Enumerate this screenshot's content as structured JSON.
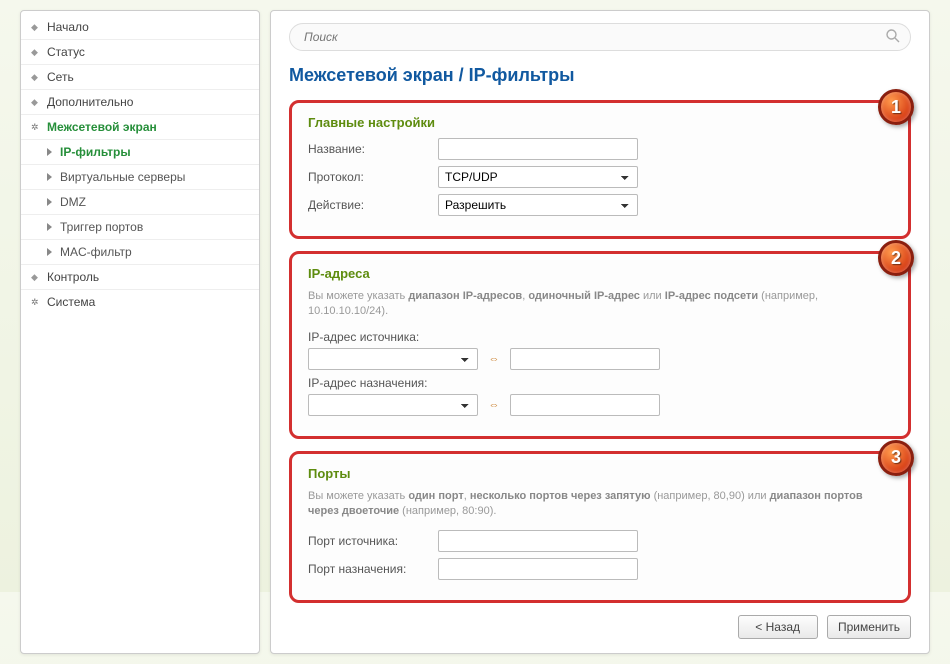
{
  "sidebar": {
    "items": [
      {
        "label": "Начало"
      },
      {
        "label": "Статус"
      },
      {
        "label": "Сеть"
      },
      {
        "label": "Дополнительно"
      },
      {
        "label": "Межсетевой экран"
      },
      {
        "label": "Контроль"
      },
      {
        "label": "Система"
      }
    ],
    "subitems": [
      {
        "label": "IP-фильтры"
      },
      {
        "label": "Виртуальные серверы"
      },
      {
        "label": "DMZ"
      },
      {
        "label": "Триггер портов"
      },
      {
        "label": "MAC-фильтр"
      }
    ]
  },
  "search": {
    "placeholder": "Поиск"
  },
  "title": "Межсетевой экран /  IP-фильтры",
  "sec1": {
    "title": "Главные настройки",
    "name_label": "Название:",
    "proto_label": "Протокол:",
    "proto_value": "TCP/UDP",
    "action_label": "Действие:",
    "action_value": "Разрешить",
    "badge": "1"
  },
  "sec2": {
    "title": "IP-адреса",
    "hint_pre": "Вы можете указать ",
    "hint_b1": "диапазон IP-адресов",
    "hint_c1": ", ",
    "hint_b2": "одиночный IP-адрес",
    "hint_c2": " или ",
    "hint_b3": "IP-адрес подсети",
    "hint_post": " (например, 10.10.10.10/24).",
    "src_label": "IP-адрес источника:",
    "dst_label": "IP-адрес назначения:",
    "badge": "2"
  },
  "sec3": {
    "title": "Порты",
    "hint_pre": "Вы можете указать ",
    "hint_b1": "один порт",
    "hint_c1": ", ",
    "hint_b2": "несколько портов через запятую",
    "hint_c2": " (например, 80,90) или ",
    "hint_b3": "диапазон портов через двоеточие",
    "hint_post": " (например, 80:90).",
    "src_label": "Порт источника:",
    "dst_label": "Порт назначения:",
    "badge": "3"
  },
  "buttons": {
    "back": "< Назад",
    "apply": "Применить"
  }
}
